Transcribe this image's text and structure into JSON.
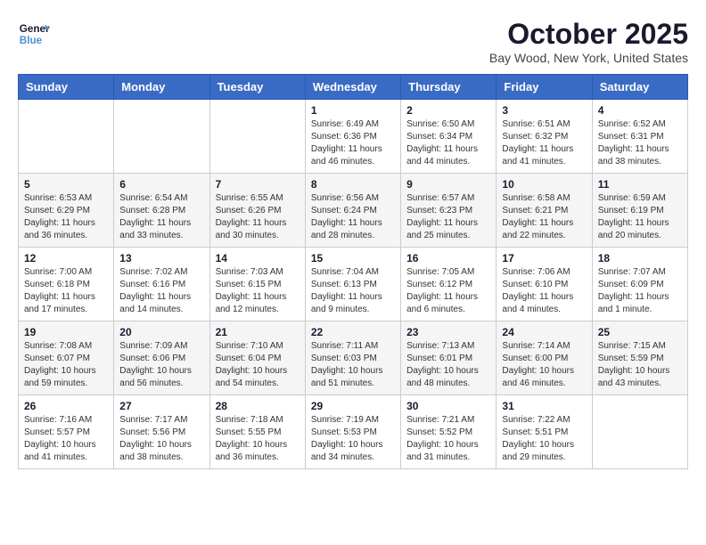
{
  "header": {
    "logo_line1": "General",
    "logo_line2": "Blue",
    "month": "October 2025",
    "location": "Bay Wood, New York, United States"
  },
  "weekdays": [
    "Sunday",
    "Monday",
    "Tuesday",
    "Wednesday",
    "Thursday",
    "Friday",
    "Saturday"
  ],
  "weeks": [
    [
      {
        "day": "",
        "info": ""
      },
      {
        "day": "",
        "info": ""
      },
      {
        "day": "",
        "info": ""
      },
      {
        "day": "1",
        "info": "Sunrise: 6:49 AM\nSunset: 6:36 PM\nDaylight: 11 hours\nand 46 minutes."
      },
      {
        "day": "2",
        "info": "Sunrise: 6:50 AM\nSunset: 6:34 PM\nDaylight: 11 hours\nand 44 minutes."
      },
      {
        "day": "3",
        "info": "Sunrise: 6:51 AM\nSunset: 6:32 PM\nDaylight: 11 hours\nand 41 minutes."
      },
      {
        "day": "4",
        "info": "Sunrise: 6:52 AM\nSunset: 6:31 PM\nDaylight: 11 hours\nand 38 minutes."
      }
    ],
    [
      {
        "day": "5",
        "info": "Sunrise: 6:53 AM\nSunset: 6:29 PM\nDaylight: 11 hours\nand 36 minutes."
      },
      {
        "day": "6",
        "info": "Sunrise: 6:54 AM\nSunset: 6:28 PM\nDaylight: 11 hours\nand 33 minutes."
      },
      {
        "day": "7",
        "info": "Sunrise: 6:55 AM\nSunset: 6:26 PM\nDaylight: 11 hours\nand 30 minutes."
      },
      {
        "day": "8",
        "info": "Sunrise: 6:56 AM\nSunset: 6:24 PM\nDaylight: 11 hours\nand 28 minutes."
      },
      {
        "day": "9",
        "info": "Sunrise: 6:57 AM\nSunset: 6:23 PM\nDaylight: 11 hours\nand 25 minutes."
      },
      {
        "day": "10",
        "info": "Sunrise: 6:58 AM\nSunset: 6:21 PM\nDaylight: 11 hours\nand 22 minutes."
      },
      {
        "day": "11",
        "info": "Sunrise: 6:59 AM\nSunset: 6:19 PM\nDaylight: 11 hours\nand 20 minutes."
      }
    ],
    [
      {
        "day": "12",
        "info": "Sunrise: 7:00 AM\nSunset: 6:18 PM\nDaylight: 11 hours\nand 17 minutes."
      },
      {
        "day": "13",
        "info": "Sunrise: 7:02 AM\nSunset: 6:16 PM\nDaylight: 11 hours\nand 14 minutes."
      },
      {
        "day": "14",
        "info": "Sunrise: 7:03 AM\nSunset: 6:15 PM\nDaylight: 11 hours\nand 12 minutes."
      },
      {
        "day": "15",
        "info": "Sunrise: 7:04 AM\nSunset: 6:13 PM\nDaylight: 11 hours\nand 9 minutes."
      },
      {
        "day": "16",
        "info": "Sunrise: 7:05 AM\nSunset: 6:12 PM\nDaylight: 11 hours\nand 6 minutes."
      },
      {
        "day": "17",
        "info": "Sunrise: 7:06 AM\nSunset: 6:10 PM\nDaylight: 11 hours\nand 4 minutes."
      },
      {
        "day": "18",
        "info": "Sunrise: 7:07 AM\nSunset: 6:09 PM\nDaylight: 11 hours\nand 1 minute."
      }
    ],
    [
      {
        "day": "19",
        "info": "Sunrise: 7:08 AM\nSunset: 6:07 PM\nDaylight: 10 hours\nand 59 minutes."
      },
      {
        "day": "20",
        "info": "Sunrise: 7:09 AM\nSunset: 6:06 PM\nDaylight: 10 hours\nand 56 minutes."
      },
      {
        "day": "21",
        "info": "Sunrise: 7:10 AM\nSunset: 6:04 PM\nDaylight: 10 hours\nand 54 minutes."
      },
      {
        "day": "22",
        "info": "Sunrise: 7:11 AM\nSunset: 6:03 PM\nDaylight: 10 hours\nand 51 minutes."
      },
      {
        "day": "23",
        "info": "Sunrise: 7:13 AM\nSunset: 6:01 PM\nDaylight: 10 hours\nand 48 minutes."
      },
      {
        "day": "24",
        "info": "Sunrise: 7:14 AM\nSunset: 6:00 PM\nDaylight: 10 hours\nand 46 minutes."
      },
      {
        "day": "25",
        "info": "Sunrise: 7:15 AM\nSunset: 5:59 PM\nDaylight: 10 hours\nand 43 minutes."
      }
    ],
    [
      {
        "day": "26",
        "info": "Sunrise: 7:16 AM\nSunset: 5:57 PM\nDaylight: 10 hours\nand 41 minutes."
      },
      {
        "day": "27",
        "info": "Sunrise: 7:17 AM\nSunset: 5:56 PM\nDaylight: 10 hours\nand 38 minutes."
      },
      {
        "day": "28",
        "info": "Sunrise: 7:18 AM\nSunset: 5:55 PM\nDaylight: 10 hours\nand 36 minutes."
      },
      {
        "day": "29",
        "info": "Sunrise: 7:19 AM\nSunset: 5:53 PM\nDaylight: 10 hours\nand 34 minutes."
      },
      {
        "day": "30",
        "info": "Sunrise: 7:21 AM\nSunset: 5:52 PM\nDaylight: 10 hours\nand 31 minutes."
      },
      {
        "day": "31",
        "info": "Sunrise: 7:22 AM\nSunset: 5:51 PM\nDaylight: 10 hours\nand 29 minutes."
      },
      {
        "day": "",
        "info": ""
      }
    ]
  ]
}
